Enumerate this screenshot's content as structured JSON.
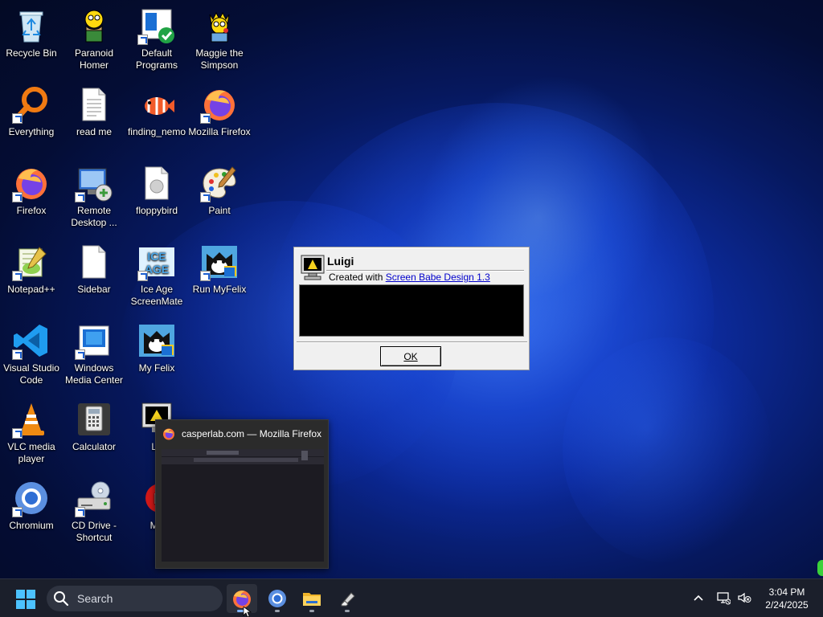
{
  "desktop": {
    "icons": [
      {
        "label": "Recycle Bin"
      },
      {
        "label": "Paranoid Homer"
      },
      {
        "label": "Default Programs"
      },
      {
        "label": "Maggie the Simpson"
      },
      {
        "label": "Everything"
      },
      {
        "label": "read me"
      },
      {
        "label": "finding_nemo"
      },
      {
        "label": "Mozilla Firefox"
      },
      {
        "label": "Firefox"
      },
      {
        "label": "Remote Desktop ..."
      },
      {
        "label": "floppybird"
      },
      {
        "label": "Paint"
      },
      {
        "label": "Notepad++"
      },
      {
        "label": "Sidebar"
      },
      {
        "label": "Ice Age ScreenMate"
      },
      {
        "label": "Run MyFelix"
      },
      {
        "label": "Visual Studio Code"
      },
      {
        "label": "Windows Media Center"
      },
      {
        "label": "My Felix"
      },
      {
        "label": "VLC media player"
      },
      {
        "label": "Calculator"
      },
      {
        "label": "Lu"
      },
      {
        "label": "Chromium"
      },
      {
        "label": "CD Drive - Shortcut"
      },
      {
        "label": "M8"
      }
    ]
  },
  "dialog": {
    "title": "Luigi",
    "created_prefix": "Created with",
    "created_link": "Screen Babe Design 1.3",
    "ok_label": "OK"
  },
  "preview": {
    "title": "casperlab.com — Mozilla Firefox"
  },
  "taskbar": {
    "search_label": "Search",
    "apps": [
      "firefox-icon",
      "chromium-icon",
      "file-explorer-icon",
      "eraser-app-icon"
    ],
    "clock_time": "3:04 PM",
    "clock_date": "2/24/2025"
  },
  "colors": {
    "accent": "#7fb4ff",
    "taskbar": "#1b1f2b",
    "dialog_bg": "#f0f0f0",
    "link": "#0000cc"
  }
}
